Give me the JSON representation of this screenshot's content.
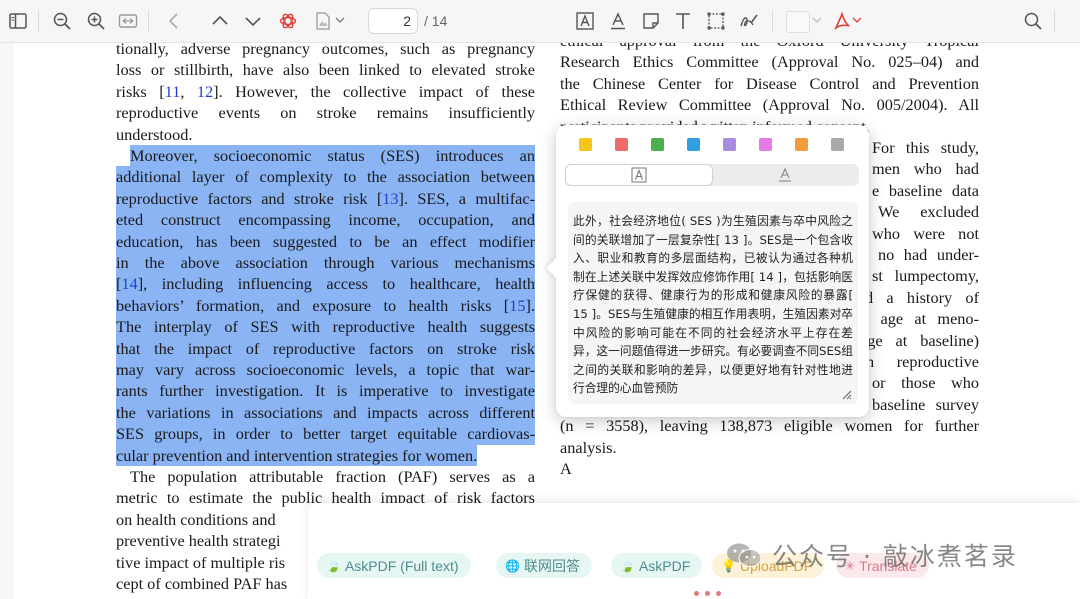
{
  "toolbar": {
    "current_page": "2",
    "total_pages": "/ 14",
    "icons": [
      "sidebar-toggle-icon",
      "zoom-out-icon",
      "zoom-in-icon",
      "fit-width-icon",
      "back-icon",
      "page-up-icon",
      "page-down-icon",
      "chatgpt-icon",
      "document-tools-icon",
      "text-box-icon",
      "underline-icon",
      "note-icon",
      "text-icon",
      "select-region-icon",
      "sign-icon",
      "color-swatch",
      "pdf-export-icon",
      "search-icon"
    ]
  },
  "document": {
    "left_column": [
      {
        "text": "tionally, adverse pregnancy outcomes, such as pregnancy",
        "hl": false
      },
      {
        "text": "loss or stillbirth, have also been linked to elevated stroke",
        "hl": false
      },
      {
        "text": "risks [11, 12]. However, the collective impact of these",
        "hl": false
      },
      {
        "text": "reproductive events on stroke remains insufficiently",
        "hl": false
      },
      {
        "text": "understood.",
        "hl": false,
        "last": true
      },
      {
        "text": "Moreover, socioeconomic status (SES) introduces an",
        "hl": true,
        "indent": true
      },
      {
        "text": "additional layer of complexity to the association between",
        "hl": true
      },
      {
        "text": "reproductive factors and stroke risk [13]. SES, a multifac-",
        "hl": true
      },
      {
        "text": "eted construct encompassing income, occupation, and",
        "hl": true
      },
      {
        "text": "education, has been suggested to be an effect modifier",
        "hl": true
      },
      {
        "text": "in the above association through various mechanisms",
        "hl": true
      },
      {
        "text": "[14], including influencing access to healthcare, health",
        "hl": true
      },
      {
        "text": "behaviors’ formation, and exposure to health risks [15].",
        "hl": true
      },
      {
        "text": "The interplay of SES with reproductive health suggests",
        "hl": true
      },
      {
        "text": "that the impact of reproductive factors on stroke risk",
        "hl": true
      },
      {
        "text": "may vary across socioeconomic levels, a topic that war-",
        "hl": true
      },
      {
        "text": "rants further investigation. It is imperative to investigate",
        "hl": true
      },
      {
        "text": "the variations in associations and impacts across different",
        "hl": true
      },
      {
        "text": "SES groups, in order to better target equitable cardiovas-",
        "hl": true
      },
      {
        "text": "cular prevention and intervention strategies for women.",
        "hl": true,
        "last": true
      },
      {
        "text": "The population attributable fraction (PAF) serves as a",
        "hl": false,
        "indent": true
      },
      {
        "text": "metric to estimate the public health impact of risk factors",
        "hl": false
      },
      {
        "text": "on health conditions and",
        "hl": false,
        "last": true
      },
      {
        "text": "preventive health strategi",
        "hl": false,
        "last": true
      },
      {
        "text": "tive impact of multiple ris",
        "hl": false,
        "last": true
      },
      {
        "text": "cept of combined PAF has",
        "hl": false,
        "last": true
      }
    ],
    "right_column": [
      {
        "text": "ethical approval from the Oxford University Tropical"
      },
      {
        "text": "Research Ethics Committee (Approval No. 025–04) and"
      },
      {
        "text": "the Chinese Center for Disease Control and Prevention"
      },
      {
        "text": "Ethical Review Committee (Approval No. 005/2004). All"
      },
      {
        "text": "participants provided written informed consent.",
        "last": true
      },
      {
        "text": "For this study,"
      },
      {
        "text": "men who had"
      },
      {
        "text": "e baseline data"
      },
      {
        "text": "We excluded"
      },
      {
        "text": "who were not"
      },
      {
        "text": "no had under-"
      },
      {
        "text": "st lumpectomy,"
      },
      {
        "text": "d a history of"
      },
      {
        "text": "e age at meno-"
      },
      {
        "text": "age at baseline)"
      },
      {
        "text": "n reproductive"
      },
      {
        "text": "or those who"
      },
      {
        "text": "baseline survey"
      },
      {
        "text": "(n = 3558), leaving 138,873 eligible women for further"
      },
      {
        "text": "analysis.",
        "last": true
      },
      {
        "text": "A"
      }
    ]
  },
  "popup": {
    "swatches": [
      "#f5c518",
      "#f06a6a",
      "#4cae4c",
      "#2f9fe0",
      "#a98be0",
      "#e77be6",
      "#f29b3c",
      "#a9a9a9"
    ],
    "modes": [
      "highlight-text",
      "underline-text"
    ],
    "translation": "此外，社会经济地位( SES )为生殖因素与卒中风险之间的关联增加了一层复杂性[ 13 ]。SES是一个包含收入、职业和教育的多层面结构，已被认为通过各种机制在上述关联中发挥效应修饰作用[ 14 ]，包括影响医疗保健的获得、健康行为的形成和健康风险的暴露[ 15 ]。SES与生殖健康的相互作用表明，生殖因素对卒中风险的影响可能在不同的社会经济水平上存在差异，这一问题值得进一步研究。有必要调查不同SES组之间的关联和影响的差异，以便更好地有针对性地进行合理的心血管预防"
  },
  "assistant": {
    "chips": [
      {
        "label": "AskPDF (Full text)",
        "icon": "leaf-icon",
        "bg": "#e6f6f3"
      },
      {
        "label": "联网回答",
        "icon": "globe-icon",
        "bg": "#e6f6f3"
      },
      {
        "label": "AskPDF",
        "icon": "leaf-icon",
        "bg": "#e6f6f3"
      },
      {
        "label": "UploadPDF",
        "icon": "bulb-icon",
        "bg": "#fdf1d8"
      },
      {
        "label": "Translate",
        "icon": "sparkle-icon",
        "bg": "#fbe8ea"
      }
    ]
  },
  "watermark": {
    "text": "公众号 · 敲冰煮茗录"
  },
  "colors": {
    "highlight": "#8ab4f4",
    "reference_link": "#1f3fcf",
    "accent_red": "#e0403a"
  }
}
